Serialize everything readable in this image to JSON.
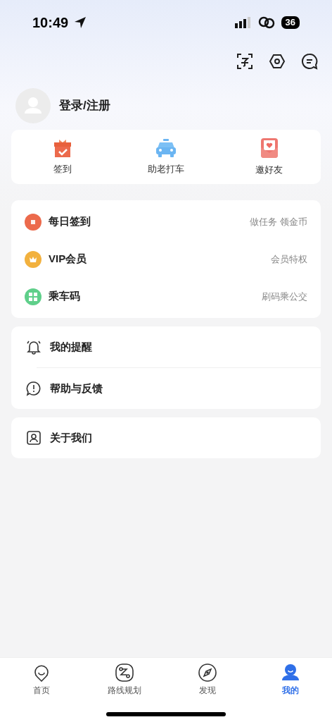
{
  "status_bar": {
    "time": "10:49",
    "battery": "36"
  },
  "profile": {
    "login": "登录/注册"
  },
  "quick_actions": [
    {
      "label": "签到"
    },
    {
      "label": "助老打车"
    },
    {
      "label": "邀好友"
    }
  ],
  "services": [
    {
      "label": "每日签到",
      "hint": "做任务 领金币",
      "color": "#ec6a4c"
    },
    {
      "label": "VIP会员",
      "hint": "会员特权",
      "color": "#f2b13e"
    },
    {
      "label": "乘车码",
      "hint": "刷码乘公交",
      "color": "#5fcf8a"
    }
  ],
  "settings": [
    {
      "label": "我的提醒"
    },
    {
      "label": "帮助与反馈"
    }
  ],
  "about": [
    {
      "label": "关于我们"
    }
  ],
  "tabs": [
    {
      "label": "首页",
      "selected": false
    },
    {
      "label": "路线规划",
      "selected": false
    },
    {
      "label": "发现",
      "selected": false
    },
    {
      "label": "我的",
      "selected": true
    }
  ]
}
